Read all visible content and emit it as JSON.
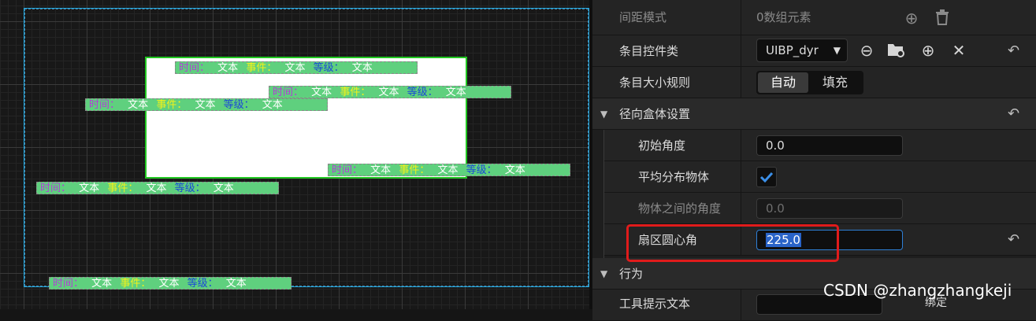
{
  "canvas": {
    "item_label_time": "时间：",
    "item_label_event": "事件：",
    "item_label_level": "等级：",
    "item_text": "文本"
  },
  "details": {
    "spacing_mode": {
      "label": "间距模式",
      "value": "0数组元素"
    },
    "entry_widget_class": {
      "label": "条目控件类",
      "value": "UIBP_dyr"
    },
    "entry_size_rule": {
      "label": "条目大小规则",
      "options": [
        "自动",
        "填充"
      ],
      "selected": "自动"
    },
    "radial_section": {
      "label": "径向盒体设置"
    },
    "start_angle": {
      "label": "初始角度",
      "value": "0.0"
    },
    "distribute_evenly": {
      "label": "平均分布物体",
      "checked": true
    },
    "angle_between": {
      "label": "物体之间的角度",
      "value": "0.0"
    },
    "sector_angle": {
      "label": "扇区圆心角",
      "value": "225.0"
    },
    "behavior_section": {
      "label": "行为"
    },
    "tooltip_text": {
      "label": "工具提示文本",
      "bind_label": "绑定"
    }
  },
  "watermark": "CSDN @zhangzhangkeji",
  "colors": {
    "time": "#b23ed6",
    "event": "#f2f21a",
    "level": "#1c4ad6",
    "item_bg": "#5fd07e",
    "highlight": "#e01b1b",
    "selection": "#2a64c8"
  }
}
